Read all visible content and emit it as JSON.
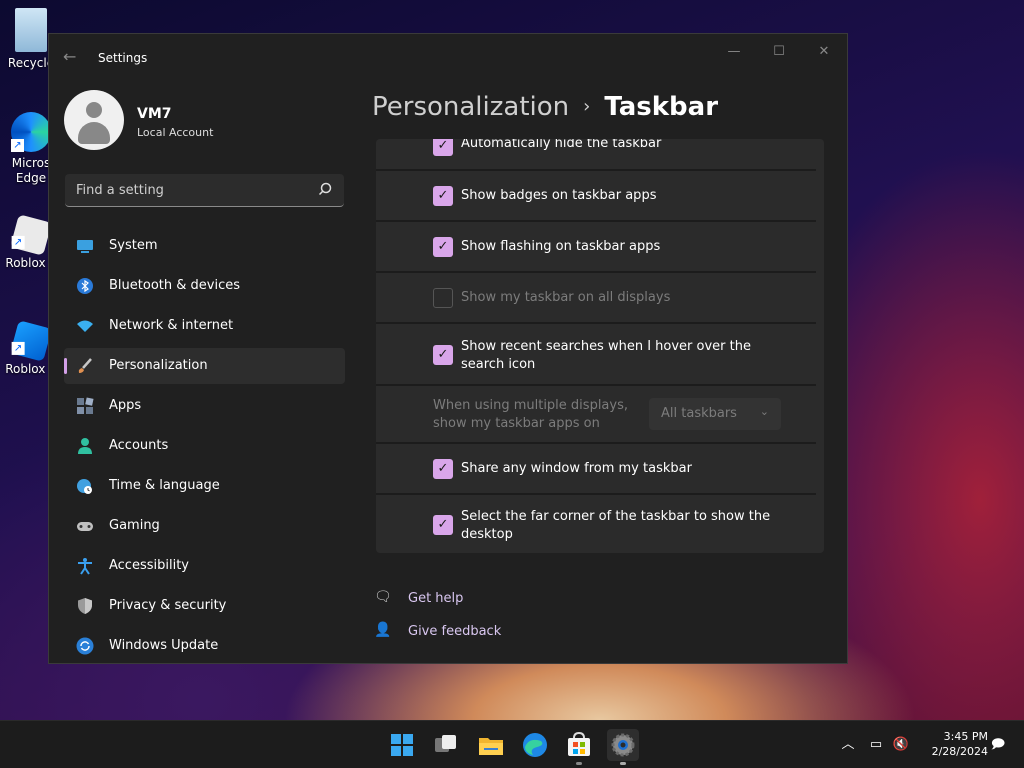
{
  "desktop": {
    "icons": [
      {
        "label": "Recycle",
        "icon": "recycle-bin-icon"
      },
      {
        "label": "Micros Edge",
        "icon": "edge-icon"
      },
      {
        "label": "Roblox P",
        "icon": "roblox-player-icon"
      },
      {
        "label": "Roblox S",
        "icon": "roblox-studio-icon"
      }
    ]
  },
  "window": {
    "title": "Settings",
    "controls": {
      "minimize": "—",
      "maximize": "☐",
      "close": "✕"
    }
  },
  "profile": {
    "name": "VM7",
    "account_type": "Local Account"
  },
  "search": {
    "placeholder": "Find a setting"
  },
  "nav": {
    "items": [
      {
        "label": "System",
        "icon": "system-icon",
        "color": "#3aa0e0"
      },
      {
        "label": "Bluetooth & devices",
        "icon": "bluetooth-icon",
        "color": "#3a8ae0"
      },
      {
        "label": "Network & internet",
        "icon": "wifi-icon",
        "color": "#3ab0f0"
      },
      {
        "label": "Personalization",
        "icon": "brush-icon",
        "color": "#e0a060",
        "active": true
      },
      {
        "label": "Apps",
        "icon": "apps-icon",
        "color": "#a0b0c8"
      },
      {
        "label": "Accounts",
        "icon": "accounts-icon",
        "color": "#30c0a0"
      },
      {
        "label": "Time & language",
        "icon": "time-language-icon",
        "color": "#40a0e0"
      },
      {
        "label": "Gaming",
        "icon": "gaming-icon",
        "color": "#c0c0c0"
      },
      {
        "label": "Accessibility",
        "icon": "accessibility-icon",
        "color": "#3aa0f0"
      },
      {
        "label": "Privacy & security",
        "icon": "shield-icon",
        "color": "#a0a0a0"
      },
      {
        "label": "Windows Update",
        "icon": "update-icon",
        "color": "#3aa0e0"
      }
    ]
  },
  "breadcrumb": {
    "parent": "Personalization",
    "separator": "›",
    "current": "Taskbar"
  },
  "settings": {
    "rows": [
      {
        "label": "Automatically hide the taskbar",
        "checked": true
      },
      {
        "label": "Show badges on taskbar apps",
        "checked": true
      },
      {
        "label": "Show flashing on taskbar apps",
        "checked": true
      },
      {
        "label": "Show my taskbar on all displays",
        "checked": false,
        "disabled": true
      },
      {
        "label": "Show recent searches when I hover over the search icon",
        "checked": true
      },
      {
        "label": "Share any window from my taskbar",
        "checked": true
      },
      {
        "label": "Select the far corner of the taskbar to show the desktop",
        "checked": true
      }
    ],
    "multi_display": {
      "label": "When using multiple displays, show my taskbar apps on",
      "value": "All taskbars"
    }
  },
  "links": {
    "help": "Get help",
    "feedback": "Give feedback"
  },
  "taskbar": {
    "apps": [
      "start-icon",
      "task-view-icon",
      "file-explorer-icon",
      "edge-icon",
      "store-icon",
      "settings-icon"
    ],
    "time": "3:45 PM",
    "date": "2/28/2024"
  },
  "colors": {
    "accent": "#d9a6ea",
    "window_bg": "#202020",
    "card_bg": "#2b2b2b"
  }
}
